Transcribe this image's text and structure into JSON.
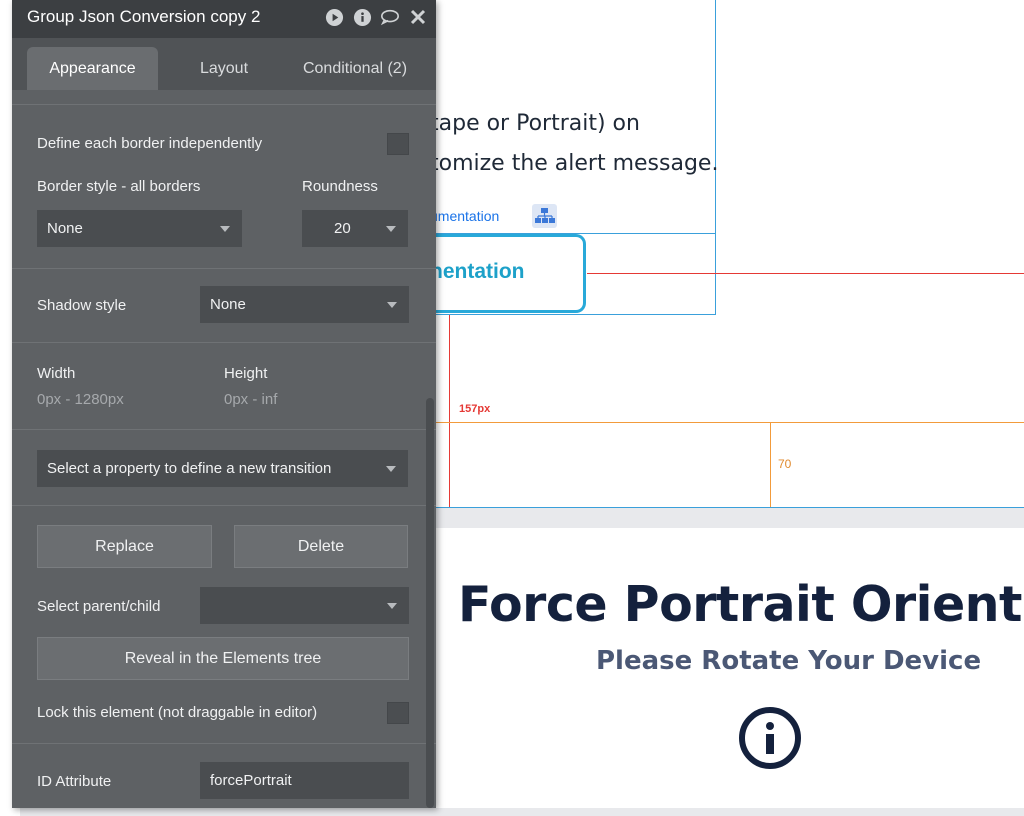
{
  "canvas": {
    "line_1": "tape or Portrait) on",
    "line_2": "tomize the alert message.",
    "doc_link": "umentation",
    "button_text": "nentation",
    "red_measure": "157px",
    "orange_measure": "70",
    "big_title": "Force Portrait Orientati",
    "subtitle": "Please Rotate Your Device",
    "icons": {
      "doc": "sitemap-icon",
      "info": "info-circle-icon"
    }
  },
  "panel": {
    "title": "Group Json Conversion copy 2",
    "header_icons": [
      "play-icon",
      "info-icon",
      "comment-icon",
      "close-icon"
    ],
    "tabs": [
      {
        "label": "Appearance",
        "active": true
      },
      {
        "label": "Layout",
        "active": false
      },
      {
        "label": "Conditional (2)",
        "active": false
      }
    ],
    "define_border_label": "Define each border independently",
    "border_style_label": "Border style - all borders",
    "border_style_value": "None",
    "roundness_label": "Roundness",
    "roundness_value": "20",
    "shadow_style_label": "Shadow style",
    "shadow_style_value": "None",
    "width_label": "Width",
    "width_value": "0px - 1280px",
    "height_label": "Height",
    "height_value": "0px - inf",
    "transition_placeholder": "Select a property to define a new transition",
    "replace_label": "Replace",
    "delete_label": "Delete",
    "select_parent_label": "Select parent/child",
    "select_parent_value": "",
    "reveal_label": "Reveal in the Elements tree",
    "lock_label": "Lock this element (not draggable in editor)",
    "id_attribute_label": "ID Attribute",
    "id_attribute_value": "forcePortrait"
  },
  "colors": {
    "panel_bg": "#5e6164",
    "header_bg": "#3c3f42",
    "accent_blue": "#29a9d9",
    "measure_red": "#e53935",
    "measure_orange": "#f29b3b",
    "title_navy": "#14213d"
  }
}
